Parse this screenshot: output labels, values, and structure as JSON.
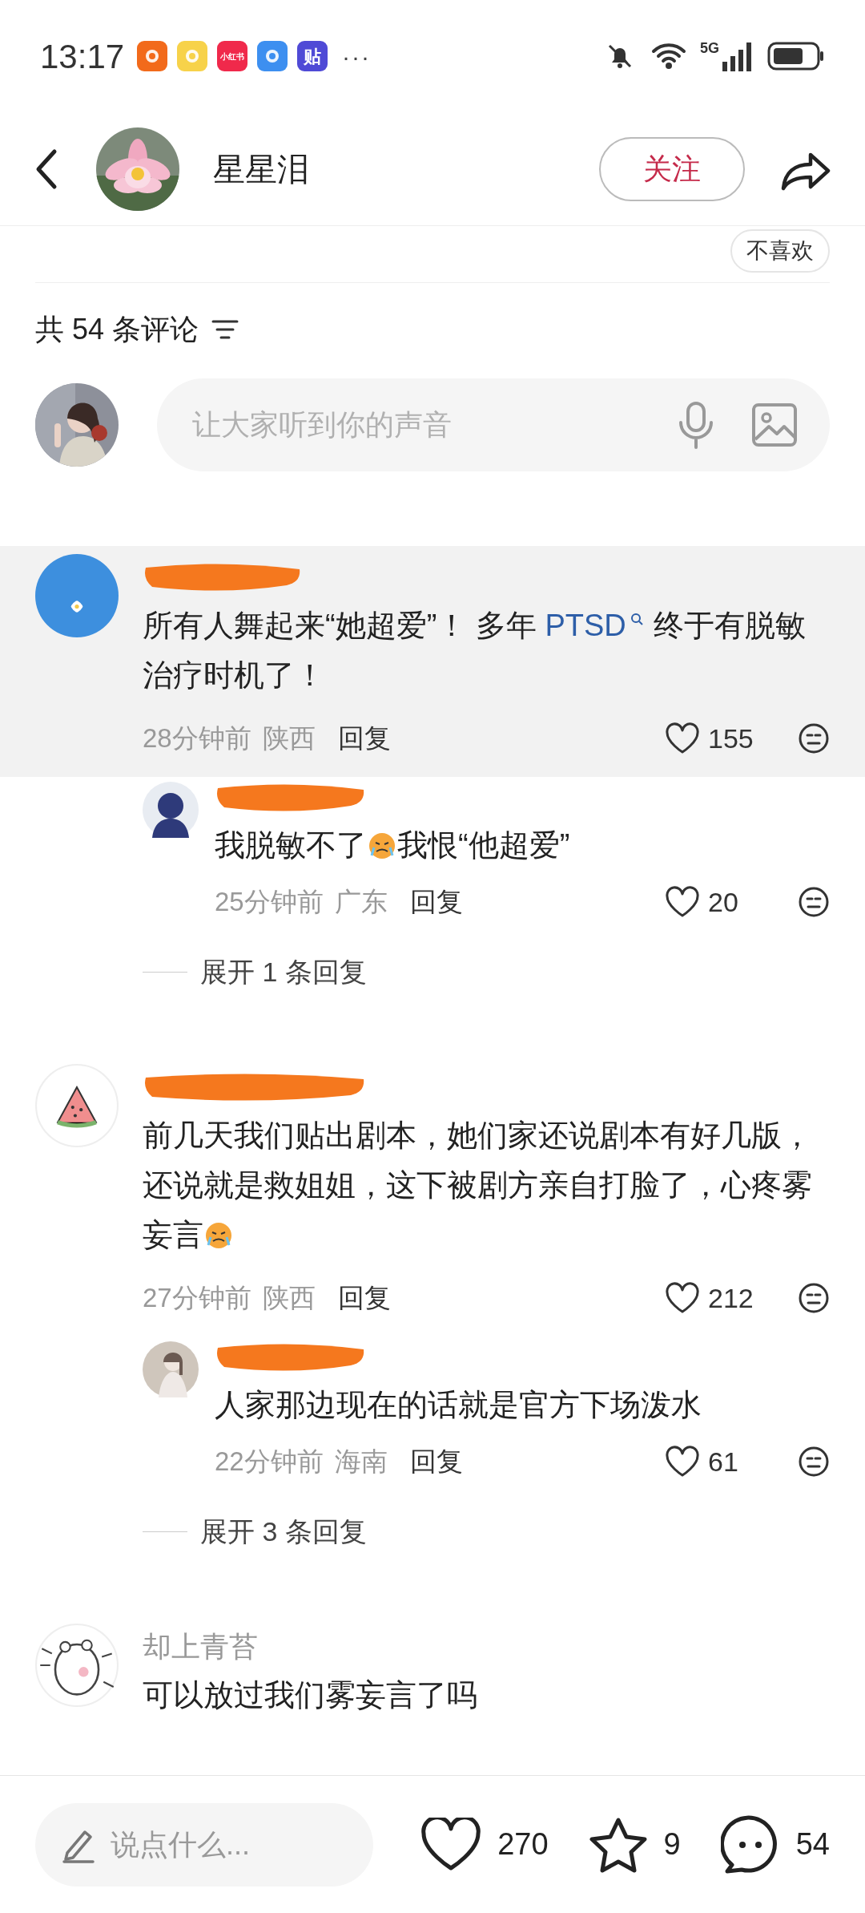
{
  "status_bar": {
    "time": "13:17",
    "app_icons": [
      {
        "color": "#f26a1b"
      },
      {
        "color": "#f7d24a"
      },
      {
        "color": "#f0294b",
        "label": "小红书"
      },
      {
        "color": "#3d8ff0"
      },
      {
        "color": "#4f4ad6",
        "label": "贴"
      }
    ],
    "more": "···",
    "network": "5G"
  },
  "header": {
    "title": "星星泪",
    "follow_button": "关注"
  },
  "dislike_button": "不喜欢",
  "comments_header": {
    "title": "共 54 条评论"
  },
  "composer": {
    "placeholder": "让大家听到你的声音"
  },
  "comments": [
    {
      "highlighted": true,
      "segments": [
        {
          "kind": "text",
          "text": "所有人舞起来“她超爱”！ 多年 "
        },
        {
          "kind": "link",
          "text": "PTSD"
        },
        {
          "kind": "text",
          "text": " 终于有脱敏治疗时机了！"
        }
      ],
      "time": "28分钟前",
      "region": "陕西",
      "reply": "回复",
      "likes": "155",
      "replies": [
        {
          "segments": [
            {
              "kind": "text",
              "text": "我脱敏不了"
            },
            {
              "kind": "emoji"
            },
            {
              "kind": "text",
              "text": "我恨“他超爱”"
            }
          ],
          "time": "25分钟前",
          "region": "广东",
          "reply": "回复",
          "likes": "20"
        }
      ],
      "expand": "展开 1 条回复"
    },
    {
      "highlighted": false,
      "segments": [
        {
          "kind": "text",
          "text": "前几天我们贴出剧本，她们家还说剧本有好几版，还说就是救姐姐，这下被剧方亲自打脸了，心疼雾妄言"
        },
        {
          "kind": "emoji"
        }
      ],
      "time": "27分钟前",
      "region": "陕西",
      "reply": "回复",
      "likes": "212",
      "replies": [
        {
          "segments": [
            {
              "kind": "text",
              "text": "人家那边现在的话就是官方下场泼水"
            }
          ],
          "time": "22分钟前",
          "region": "海南",
          "reply": "回复",
          "likes": "61"
        }
      ],
      "expand": "展开 3 条回复"
    },
    {
      "highlighted": false,
      "name": "却上青苔",
      "segments": [
        {
          "kind": "text",
          "text": "可以放过我们雾妄言了吗"
        }
      ]
    }
  ],
  "bottom_bar": {
    "placeholder": "说点什么...",
    "likes": "270",
    "favorites": "9",
    "comments": "54"
  }
}
